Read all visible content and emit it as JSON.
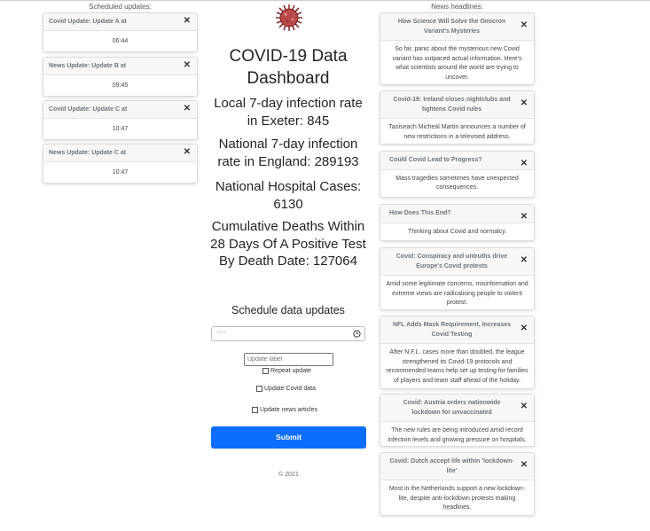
{
  "scheduled_title": "Scheduled updates:",
  "news_title": "News headlines:",
  "scheduled_updates": [
    {
      "title": "Covid Update: Update A at",
      "time": "06:44"
    },
    {
      "title": "News Update: Update B at",
      "time": "09:45"
    },
    {
      "title": "Covid Update: Update C at",
      "time": "10:47"
    },
    {
      "title": "News Update: Update C at",
      "time": "10:47"
    }
  ],
  "close_symbol": "✕",
  "dashboard": {
    "title": "COVID-19 Data Dashboard",
    "local_rate": "Local 7-day infection rate in Exeter: 845",
    "national_rate": "National 7-day infection rate in England: 289193",
    "hospital_cases": "National Hospital Cases: 6130",
    "cumulative_deaths": "Cumulative Deaths Within 28 Days Of A Positive Test By Death Date: 127064"
  },
  "form": {
    "heading": "Schedule data updates",
    "time_placeholder": "--:--",
    "label_placeholder": "Update label",
    "repeat_label": "Repeat update",
    "covid_label": "Update Covid data",
    "news_label": "Update news articles",
    "submit_label": "Submit"
  },
  "copyright": "© 2021",
  "news": [
    {
      "title": "How Science Will Solve the Omicron Variant's Mysteries",
      "body": "So far, panic about the mysterious new Covid variant has outpaced actual information. Here's what scientists around the world are trying to uncover."
    },
    {
      "title": "Covid-19: Ireland closes nightclubs and tightens Covid rules",
      "body": "Taoiseach Micheál Martin announces a number of new restrictions in a televised address."
    },
    {
      "title": "Could Covid Lead to Progress?",
      "body": "Mass tragedies sometimes have unexpected consequences."
    },
    {
      "title": "How Does This End?",
      "body": "Thinking about Covid and normalcy."
    },
    {
      "title": "Covid: Conspiracy and untruths drive Europe's Covid protests",
      "body": "Amid some legitimate concerns, misinformation and extreme views are radicalising people to violent protest."
    },
    {
      "title": "NFL Adds Mask Requirement, Increases Covid Testing",
      "body": "After N.F.L. cases more than doubled, the league strengthened its Covid-19 protocols and recommended teams help set up testing for families of players and team staff ahead of the holiday."
    },
    {
      "title": "Covid: Austria orders nationwide lockdown for unvaccinated",
      "body": "The new rules are being introduced amid record infection levels and growing pressure on hospitals."
    },
    {
      "title": "Covid: Dutch accept life within 'lockdown-lite'",
      "body": "Most in the Netherlands support a new lockdown-lite, despite anti-lockdown protests making headlines."
    }
  ],
  "colors": {
    "accent": "#0d6efd"
  }
}
